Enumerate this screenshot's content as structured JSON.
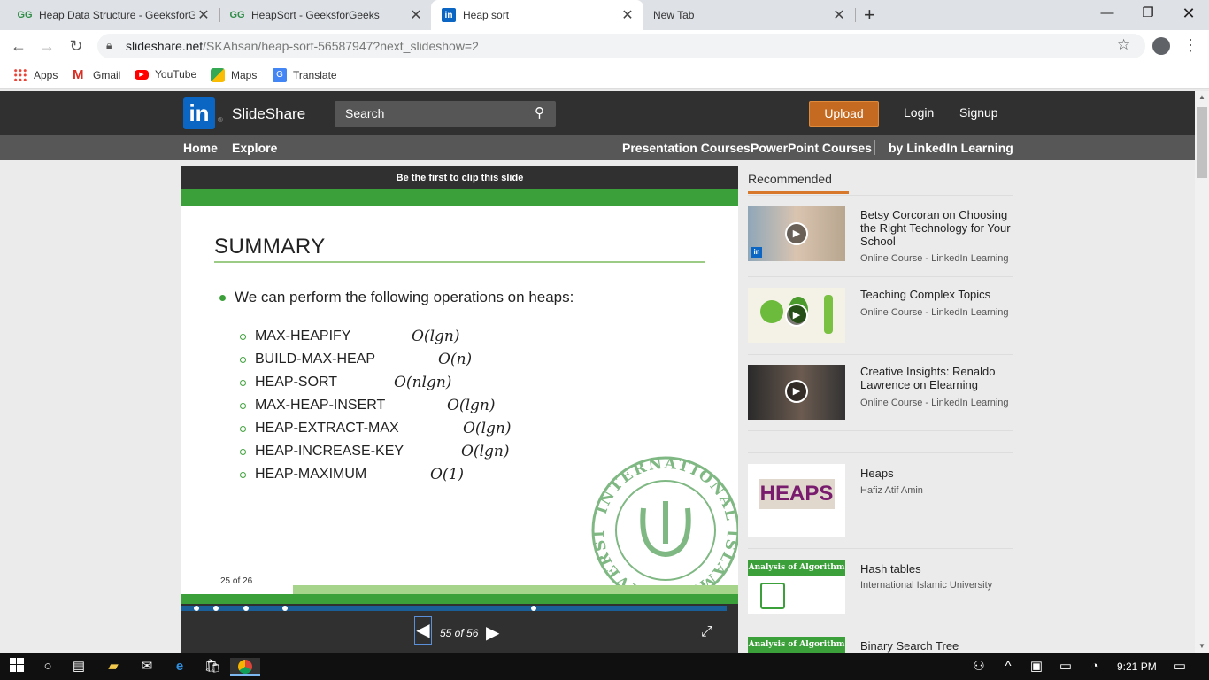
{
  "browser": {
    "tabs": [
      {
        "title": "Heap Data Structure - GeeksforG",
        "favicon": "geeksforgeeks-icon"
      },
      {
        "title": "HeapSort - GeeksforGeeks",
        "favicon": "geeksforgeeks-icon"
      },
      {
        "title": "Heap sort",
        "favicon": "linkedin-icon"
      },
      {
        "title": "New Tab",
        "favicon": ""
      }
    ],
    "url_host": "slideshare.net",
    "url_path": "/SKAhsan/heap-sort-56587947?next_slideshow=2",
    "bookmarks": [
      {
        "label": "Apps"
      },
      {
        "label": "Gmail"
      },
      {
        "label": "YouTube"
      },
      {
        "label": "Maps"
      },
      {
        "label": "Translate"
      }
    ]
  },
  "slideshare": {
    "brand": "SlideShare",
    "search_placeholder": "Search",
    "upload_label": "Upload",
    "login_label": "Login",
    "signup_label": "Signup",
    "nav": {
      "home": "Home",
      "explore": "Explore",
      "presentation_courses": "Presentation Courses",
      "powerpoint_courses": "PowerPoint Courses",
      "linkedin_learning": "by LinkedIn Learning"
    }
  },
  "player": {
    "clip_text": "Be the first to clip this slide",
    "counter": "55 of 56",
    "slide": {
      "title": "SUMMARY",
      "bullet": "We can perform the following operations on heaps:",
      "operations": [
        {
          "name": "MAX-HEAPIFY",
          "complexity": "O(lgn)"
        },
        {
          "name": "BUILD-MAX-HEAP",
          "complexity": "O(n)"
        },
        {
          "name": "HEAP-SORT",
          "complexity": "O(nlgn)"
        },
        {
          "name": "MAX-HEAP-INSERT",
          "complexity": "O(lgn)"
        },
        {
          "name": "HEAP-EXTRACT-MAX",
          "complexity": "O(lgn)"
        },
        {
          "name": "HEAP-INCREASE-KEY",
          "complexity": "O(lgn)"
        },
        {
          "name": "HEAP-MAXIMUM",
          "complexity": "O(1)"
        }
      ],
      "slide_number": "25 of 26",
      "seal_text": "INTERNATIONAL ISLAMIC UNIVERSITY"
    }
  },
  "recommended": {
    "heading": "Recommended",
    "items": [
      {
        "title": "Betsy Corcoran on Choosing the Right Technology for Your School",
        "subtitle": "Online Course - LinkedIn Learning"
      },
      {
        "title": "Teaching Complex Topics",
        "subtitle": "Online Course - LinkedIn Learning"
      },
      {
        "title": "Creative Insights: Renaldo Lawrence on Elearning",
        "subtitle": "Online Course - LinkedIn Learning"
      },
      {
        "title": "Heaps",
        "subtitle": "Hafiz Atif Amin",
        "thumb_text": "HEAPS"
      },
      {
        "title": "Hash tables",
        "subtitle": "International Islamic University",
        "thumb_text": "Analysis of Algorithm"
      },
      {
        "title": "Binary Search Tree",
        "subtitle": "",
        "thumb_text": "Analysis of Algorithm"
      }
    ]
  },
  "taskbar": {
    "time": "9:21 PM"
  },
  "colors": {
    "slideshare_header": "#303030",
    "upload_button": "#c56b21",
    "slide_green": "#3ca03a",
    "progress_blue": "#1b5f98"
  }
}
